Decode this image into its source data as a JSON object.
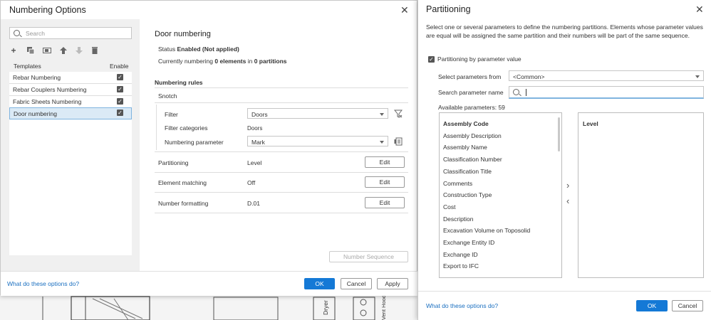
{
  "numbering_options": {
    "title": "Numbering Options",
    "search_placeholder": "Search",
    "templates_header": "Templates",
    "enable_header": "Enable",
    "templates": [
      {
        "label": "Rebar Numbering",
        "enabled": true
      },
      {
        "label": "Rebar Couplers Numbering",
        "enabled": true
      },
      {
        "label": "Fabric Sheets Numbering",
        "enabled": true
      },
      {
        "label": "Door numbering",
        "enabled": true,
        "selected": true
      }
    ],
    "detail": {
      "title": "Door numbering",
      "status_label": "Status",
      "status_value": "Enabled (Not applied)",
      "currently_prefix": "Currently numbering",
      "currently_elements": "0 elements",
      "currently_in": "in",
      "currently_partitions": "0 partitions",
      "rules_heading": "Numbering rules",
      "rule_name": "Snotch",
      "filter_label": "Filter",
      "filter_value": "Doors",
      "filter_categories_label": "Filter categories",
      "filter_categories_value": "Doors",
      "numbering_parameter_label": "Numbering parameter",
      "numbering_parameter_value": "Mark",
      "partitioning_label": "Partitioning",
      "partitioning_value": "Level",
      "element_matching_label": "Element matching",
      "element_matching_value": "Off",
      "number_formatting_label": "Number formatting",
      "number_formatting_value": "D.01",
      "edit_label": "Edit",
      "number_sequence_label": "Number Sequence"
    },
    "footer": {
      "help_link": "What do these options do?",
      "ok": "OK",
      "cancel": "Cancel",
      "apply": "Apply"
    }
  },
  "partitioning": {
    "title": "Partitioning",
    "description": "Select one or several parameters to define the numbering partitions. Elements whose parameter values are equal will be assigned the same partition and their numbers will be part of the same sequence.",
    "checkbox_label": "Partitioning by parameter value",
    "checkbox_checked": true,
    "select_from_label": "Select parameters from",
    "select_from_value": "<Common>",
    "search_label": "Search parameter name",
    "available_label": "Available parameters:",
    "available_count": "59",
    "available_params": [
      "Assembly Code",
      "Assembly Description",
      "Assembly Name",
      "Classification Number",
      "Classification Title",
      "Comments",
      "Construction Type",
      "Cost",
      "Description",
      "Excavation Volume on Toposolid",
      "Exchange Entity ID",
      "Exchange ID",
      "Export to IFC"
    ],
    "selected_params": [
      "Level"
    ],
    "footer": {
      "help_link": "What do these options do?",
      "ok": "OK",
      "cancel": "Cancel"
    }
  },
  "background": {
    "labels": [
      "Dryer",
      "Vent Hood Range"
    ]
  },
  "colors": {
    "accent": "#1479d6",
    "link": "#1a6fc0",
    "selection": "#dbeaf6"
  }
}
